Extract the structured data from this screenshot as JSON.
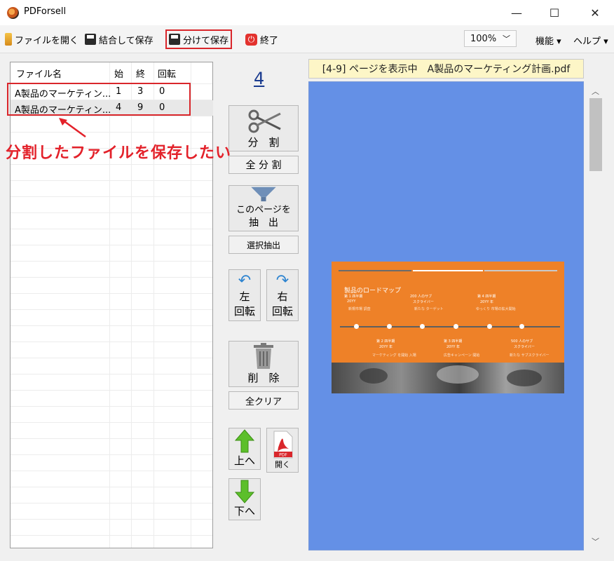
{
  "window": {
    "title": "PDForsell",
    "minimize": "—",
    "maximize": "☐",
    "close": "✕"
  },
  "toolbar": {
    "open": "ファイルを開く",
    "merge_save": "結合して保存",
    "split_save": "分けて保存",
    "quit": "終了",
    "zoom": "100%",
    "functions": "機能 ▾",
    "help": "ヘルプ ▾"
  },
  "file_table": {
    "headers": [
      "ファイル名",
      "始",
      "終",
      "回転"
    ],
    "rows": [
      {
        "name": "A製品のマーケティン...",
        "start": "1",
        "end": "3",
        "rotate": "0"
      },
      {
        "name": "A製品のマーケティン...",
        "start": "4",
        "end": "9",
        "rotate": "0"
      }
    ]
  },
  "annotation": "分割したファイルを保存したい",
  "controls": {
    "page_number": "4",
    "split": "分　割",
    "split_all": "全 分 割",
    "extract_page_line1": "このページを",
    "extract_page_line2": "抽　出",
    "extract_selected": "選択抽出",
    "rotate_left_line1": "左",
    "rotate_left_line2": "回転",
    "rotate_right_line1": "右",
    "rotate_right_line2": "回転",
    "delete": "削　除",
    "clear_all": "全クリア",
    "move_up": "上へ",
    "open_pdf": "開く",
    "move_down": "下へ",
    "pdf_badge": "PDF"
  },
  "preview": {
    "label": "[4-9] ページを表示中　A製品のマーケティング計画.pdf",
    "slide": {
      "title": "製品のロードマップ",
      "q1": "第 1 四半期",
      "q1_year": "20YY",
      "q1_note": "新規市場 調査",
      "users200": "200 人のサブ",
      "users200_sub": "スクライバー",
      "users200_note": "新たな ターゲット",
      "q4": "第 4 四半期",
      "q4_year": "20YY 年",
      "q4_note": "ゆっくり 市場の拡大開始",
      "q2": "第 2 四半期",
      "q2_year": "20YY 年",
      "q2_note": "マーケティング を開始 入場",
      "q3": "第 3 四半期",
      "q3_year": "20YY 年",
      "q3_note": "広告キャンペーン 開始",
      "users500": "500 人のサブ",
      "users500_sub": "スクライバー",
      "users500_note": "新たな サブスクライバー"
    }
  },
  "colors": {
    "highlight_red": "#d9262b",
    "annotation_red": "#e3212a",
    "preview_blue": "#6490e6",
    "slide_orange": "#ee8128"
  }
}
